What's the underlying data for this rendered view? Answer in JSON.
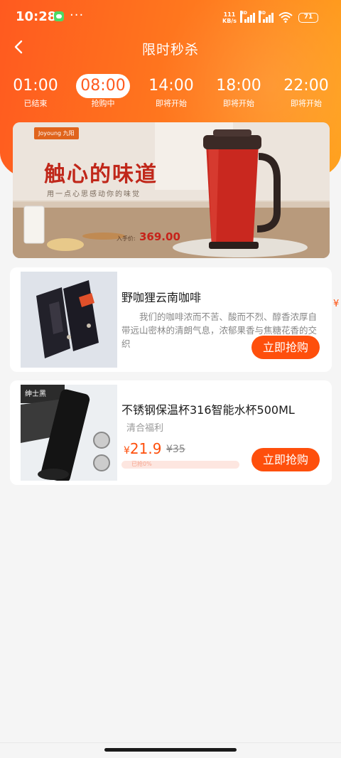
{
  "status_bar": {
    "time": "10:28",
    "more": "···",
    "speed_value": "111",
    "speed_unit": "KB/s",
    "signal_label_1": "HD",
    "signal_label_2": "HD",
    "battery": "71",
    "icons": [
      "wechat-icon",
      "signal-icon",
      "wifi-icon",
      "battery-icon"
    ]
  },
  "nav": {
    "title": "限时秒杀",
    "back_icon": "chevron-left-icon"
  },
  "time_tabs": [
    {
      "time": "01:00",
      "status": "已结束"
    },
    {
      "time": "08:00",
      "status": "抢购中",
      "active": true
    },
    {
      "time": "14:00",
      "status": "即将开始"
    },
    {
      "time": "18:00",
      "status": "即将开始"
    },
    {
      "time": "22:00",
      "status": "即将开始"
    }
  ],
  "banner": {
    "brand": "Joyoung 九阳",
    "headline": "触心的味道",
    "subline": "用一点心思感动你的味觉",
    "price_label": "入手价:",
    "price": "369.00"
  },
  "products": [
    {
      "title": "野咖狸云南咖啡",
      "description": "我们的咖啡浓而不苦、酸而不烈、醇香浓厚自带远山密林的清朗气息，浓郁果香与焦糖花香的交织",
      "button": "立即抢购"
    },
    {
      "title": "不锈钢保温杯316智能水杯500ML",
      "brand": "清合福利",
      "currency": "¥",
      "price": "21.9",
      "original_price": "¥35",
      "sold_text": "已抢0%",
      "sold_progress": 0,
      "image_label": "绅士黑",
      "button": "立即抢购"
    }
  ],
  "peek_currency": "¥",
  "colors": {
    "accent": "#fe4f0c",
    "header_start": "#ff5a1f",
    "header_end": "#ffa21d",
    "background": "#f5f5f5"
  }
}
